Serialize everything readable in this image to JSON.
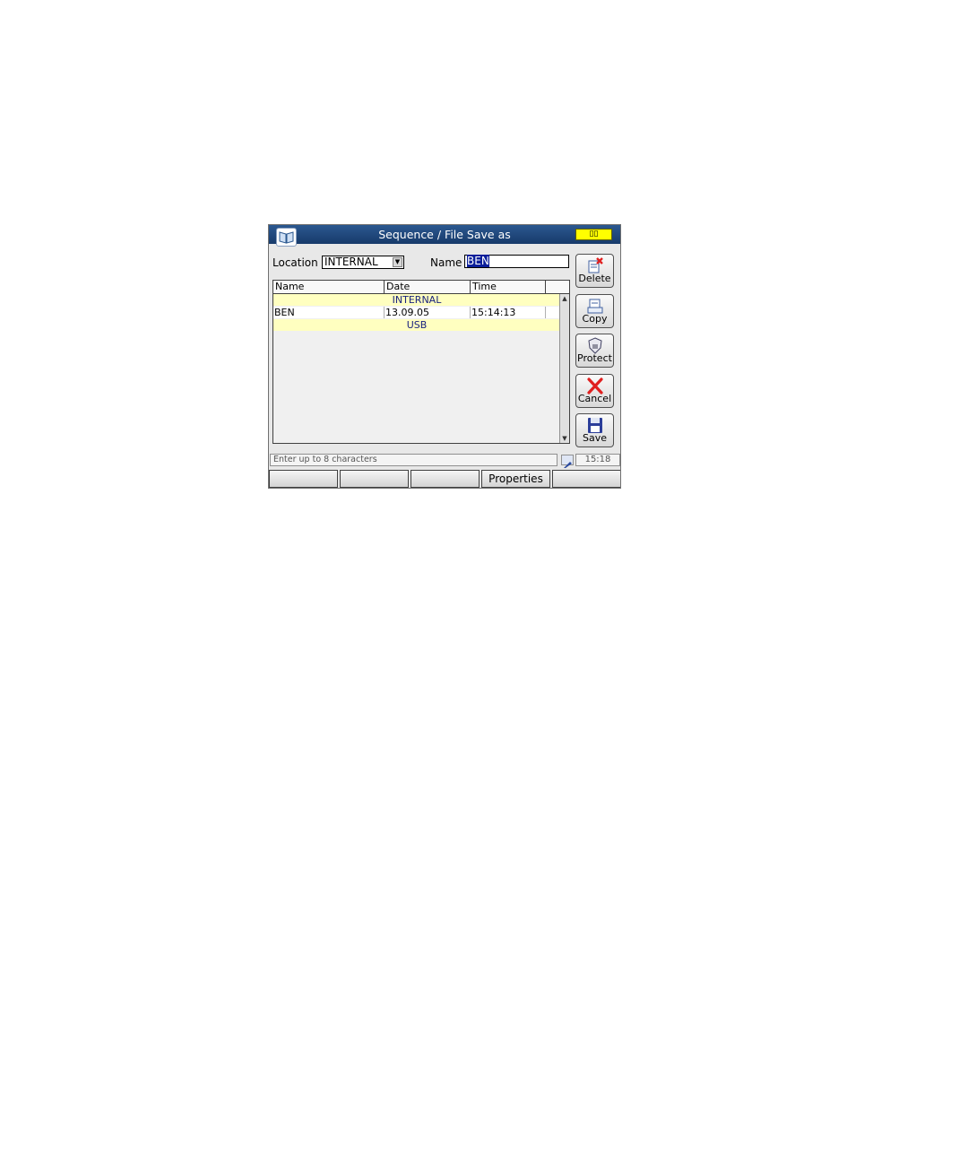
{
  "window": {
    "title": "Sequence / File Save as",
    "title_icon": "book-icon"
  },
  "location": {
    "label": "Location",
    "value": "INTERNAL"
  },
  "name_field": {
    "label": "Name",
    "value": "BEN"
  },
  "table": {
    "columns": [
      "Name",
      "Date",
      "Time"
    ],
    "groups": [
      {
        "label": "INTERNAL",
        "files": [
          {
            "name": "BEN",
            "date": "13.09.05",
            "time": "15:14:13"
          }
        ]
      },
      {
        "label": "USB",
        "files": []
      }
    ]
  },
  "side_buttons": {
    "delete": {
      "label": "Delete",
      "icon": "delete-file-icon"
    },
    "copy": {
      "label": "Copy",
      "icon": "copy-file-icon"
    },
    "protect": {
      "label": "Protect",
      "icon": "shield-icon"
    },
    "cancel": {
      "label": "Cancel",
      "icon": "red-x-icon"
    },
    "save": {
      "label": "Save",
      "icon": "floppy-disk-icon"
    }
  },
  "status": {
    "hint": "Enter up to 8 characters",
    "clock": "15:18"
  },
  "softkeys": [
    "",
    "",
    "",
    "Properties",
    ""
  ]
}
